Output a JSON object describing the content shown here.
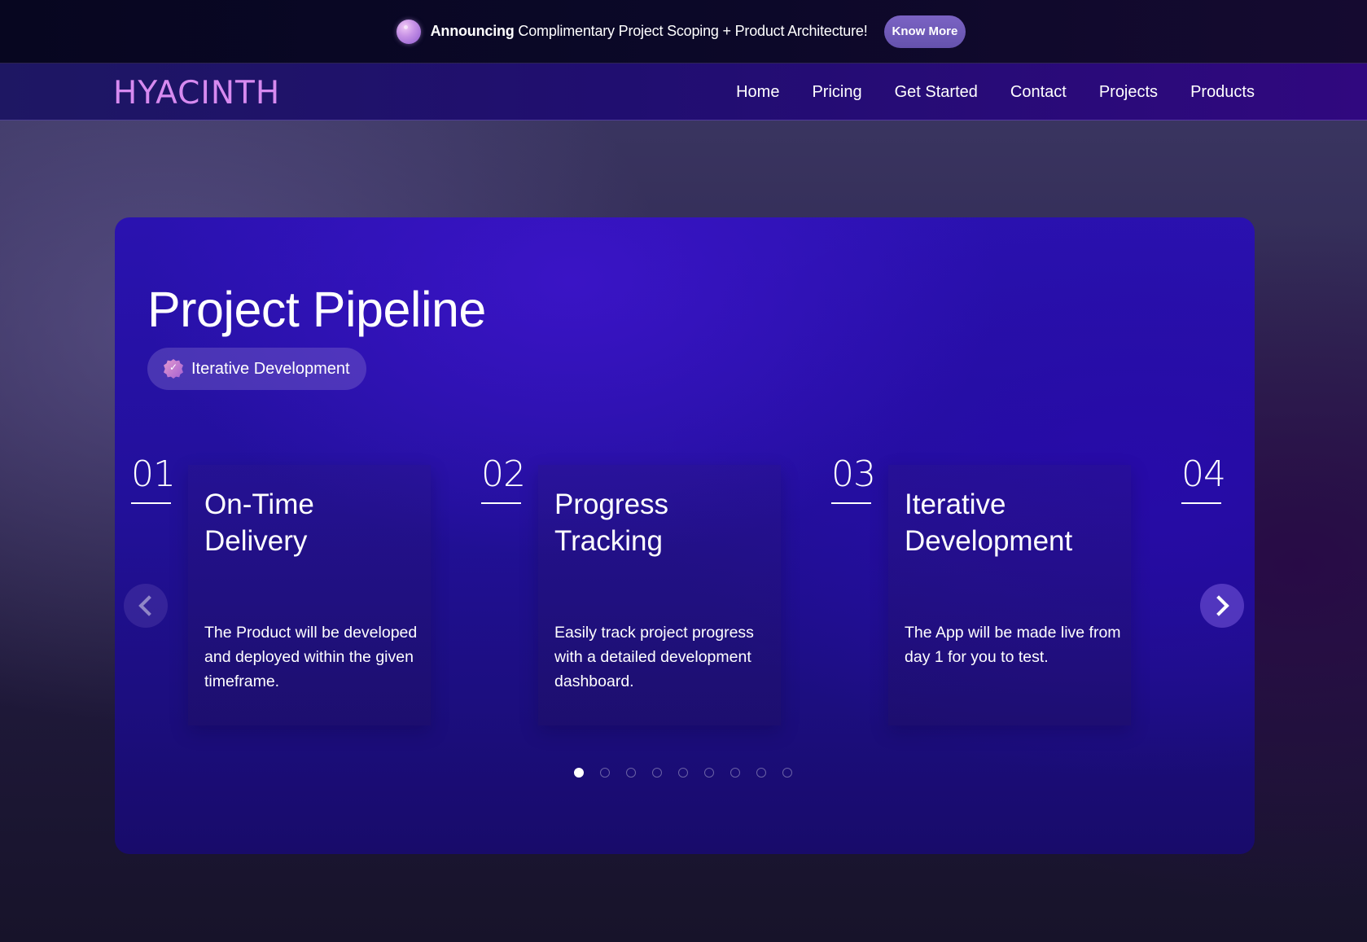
{
  "announcement": {
    "bold": "Announcing",
    "text": " Complimentary Project Scoping + Product Architecture!",
    "button": "Know More"
  },
  "nav": {
    "logo": "HYACINTH",
    "links": [
      "Home",
      "Pricing",
      "Get Started",
      "Contact",
      "Projects",
      "Products"
    ]
  },
  "section": {
    "title": "Project Pipeline",
    "badge": "Iterative Development"
  },
  "cards": [
    {
      "num": "01",
      "title_line1": "On-Time",
      "title_line2": "Delivery",
      "desc": "The Product will be developed and deployed within the given timeframe."
    },
    {
      "num": "02",
      "title_line1": "Progress",
      "title_line2": "Tracking",
      "desc": "Easily track project progress with a detailed development dashboard."
    },
    {
      "num": "03",
      "title_line1": "Iterative",
      "title_line2": "Development",
      "desc": "The App will be made live from day 1 for you to test."
    },
    {
      "num": "04"
    }
  ],
  "carousel": {
    "total_dots": 9,
    "active_index": 0
  },
  "colors": {
    "logo": "#d78af0",
    "accent": "#6552ad"
  }
}
